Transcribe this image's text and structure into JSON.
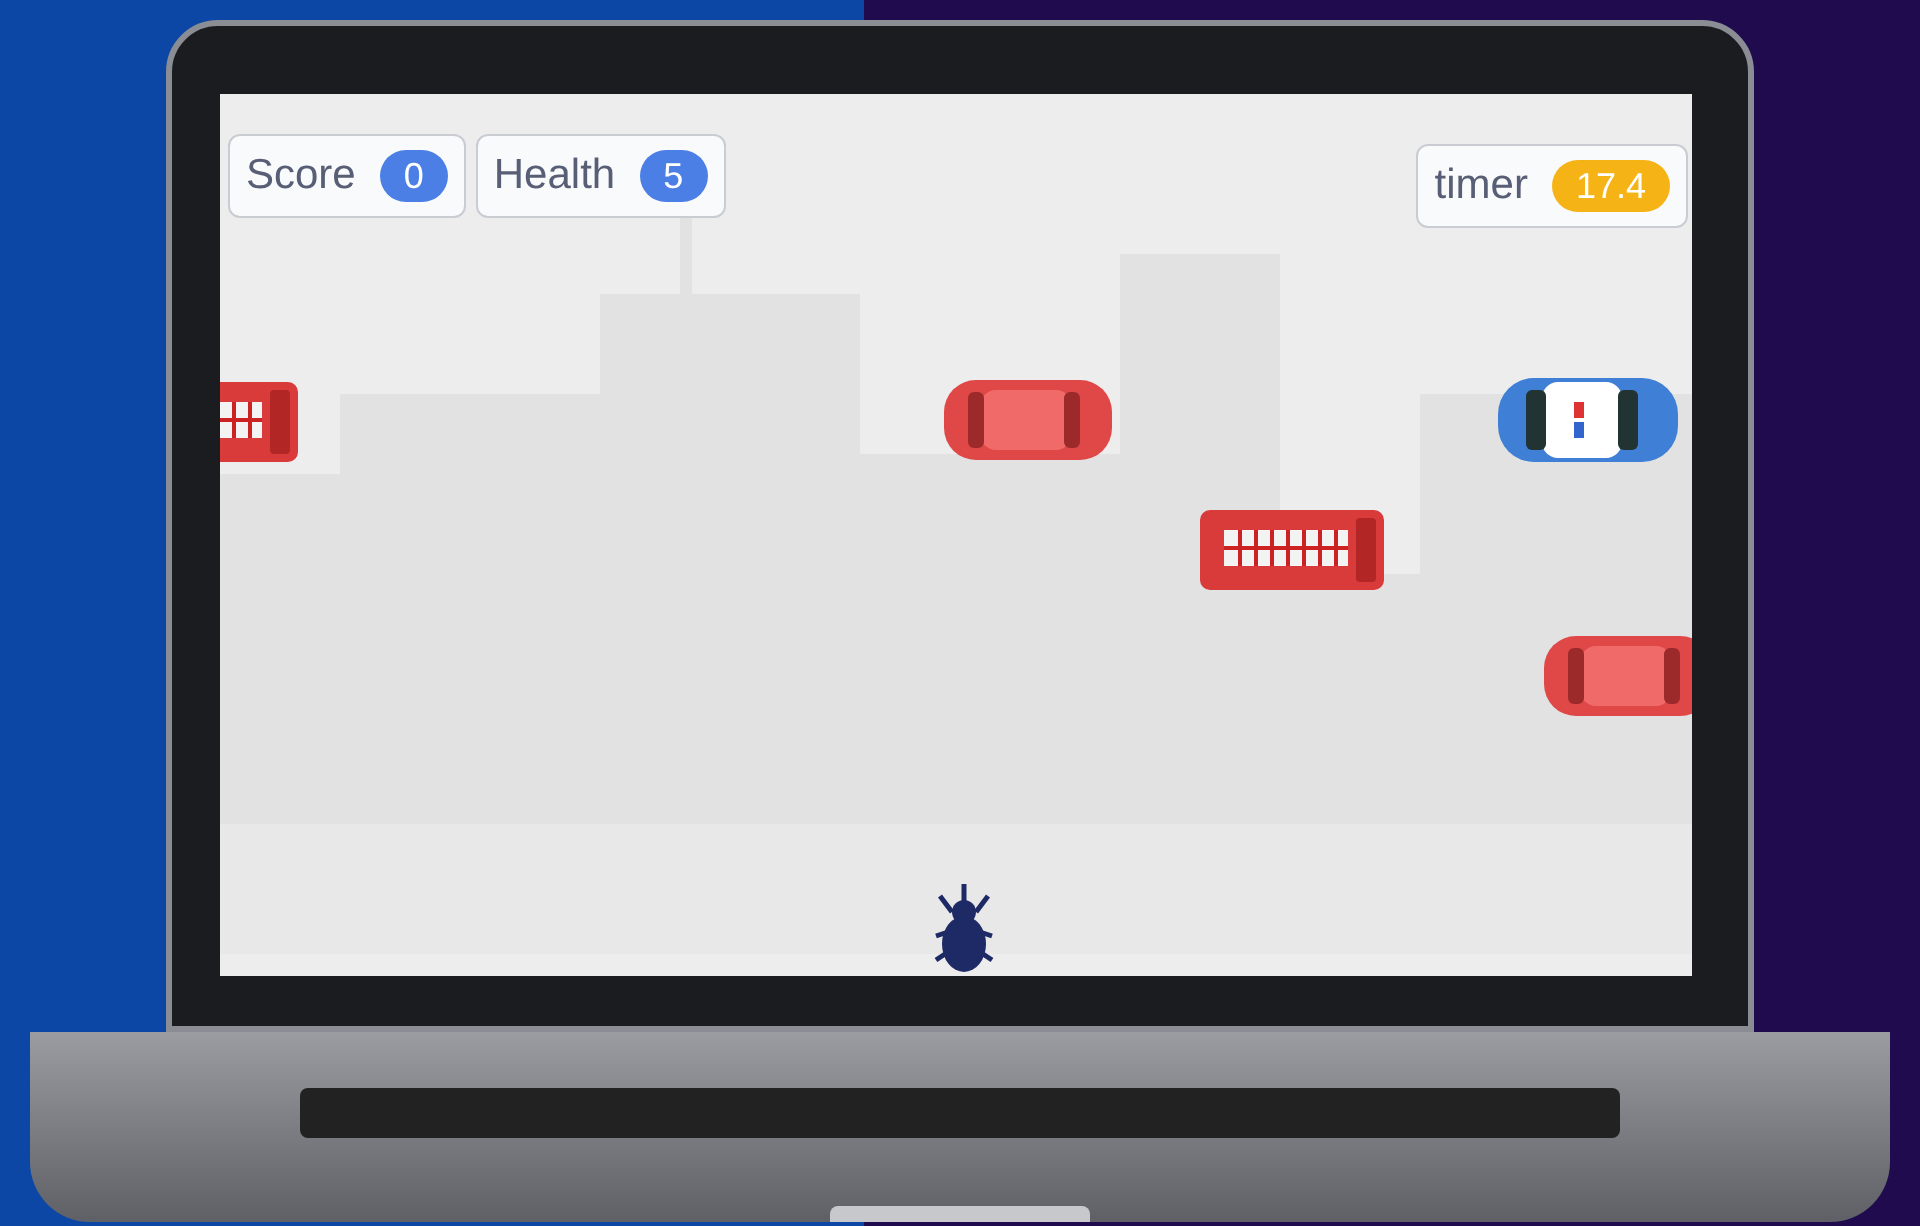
{
  "stage": {
    "left_variables": [
      {
        "label": "Score",
        "value": "0",
        "color": "#4c7fe6"
      },
      {
        "label": "Health",
        "value": "5",
        "color": "#4c7fe6"
      }
    ],
    "right_variables": [
      {
        "label": "timer",
        "value": "17.4",
        "color": "#f5b316"
      }
    ]
  }
}
